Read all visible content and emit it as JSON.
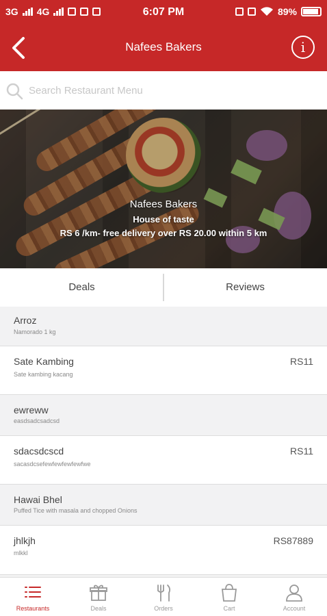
{
  "status_bar": {
    "left": [
      "3G",
      "4G"
    ],
    "time": "6:07 PM",
    "battery": "89%"
  },
  "header": {
    "title": "Nafees Bakers",
    "back_icon": "chevron-left-icon",
    "info_icon": "info-icon"
  },
  "search": {
    "placeholder": "Search Restaurant Menu"
  },
  "banner": {
    "name": "Nafees Bakers",
    "tagline": "House of taste",
    "delivery": "RS 6 /km- free delivery over RS 20.00 within 5 km"
  },
  "tabs": [
    {
      "label": "Deals"
    },
    {
      "label": "Reviews"
    }
  ],
  "menu_items": [
    {
      "name": "Arroz",
      "desc": "Namorado 1 kg",
      "price": ""
    },
    {
      "name": "Sate Kambing",
      "desc": "Sate kambing kacang",
      "price": "RS11"
    },
    {
      "name": "ewreww",
      "desc": "easdsadcsadcsd",
      "price": ""
    },
    {
      "name": "sdacsdcscd",
      "desc": "sacasdcsefewfewfewfewfwe",
      "price": "RS11"
    },
    {
      "name": "Hawai Bhel",
      "desc": "Puffed Tice with masala and chopped Onions",
      "price": ""
    },
    {
      "name": "jhlkjh",
      "desc": "mlkkl",
      "price": "RS87889"
    }
  ],
  "bottom_nav": [
    {
      "label": "Restaurants",
      "icon": "list-icon",
      "active": true
    },
    {
      "label": "Deals",
      "icon": "gift-icon",
      "active": false
    },
    {
      "label": "Orders",
      "icon": "utensils-icon",
      "active": false
    },
    {
      "label": "Cart",
      "icon": "shopping-bag-icon",
      "active": false
    },
    {
      "label": "Account",
      "icon": "user-icon",
      "active": false
    }
  ],
  "colors": {
    "primary": "#c62828",
    "active_nav": "#c62828",
    "inactive_nav": "#999999"
  }
}
